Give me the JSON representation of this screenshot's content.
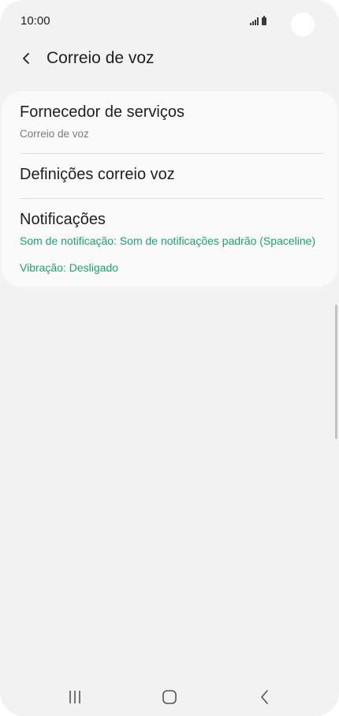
{
  "status_bar": {
    "time": "10:00"
  },
  "header": {
    "back_icon": "chevron-left-icon",
    "title": "Correio de voz"
  },
  "settings": {
    "items": [
      {
        "title": "Fornecedor de serviços",
        "subtitle": "Correio de voz"
      },
      {
        "title": "Definições correio voz"
      },
      {
        "title": "Notificações",
        "subtitle_line1": "Som de notificação: Som de notificações padrão (Spaceline)",
        "subtitle_line2": "Vibração: Desligado"
      }
    ]
  },
  "nav_bar": {
    "recents_icon": "recents-icon",
    "home_icon": "home-icon",
    "back_icon": "back-icon"
  },
  "colors": {
    "background": "#f2f2f2",
    "card": "#fafafa",
    "accent_green": "#1aa56b",
    "text_primary": "#1f1f1f",
    "text_secondary": "#7a7a7a"
  }
}
